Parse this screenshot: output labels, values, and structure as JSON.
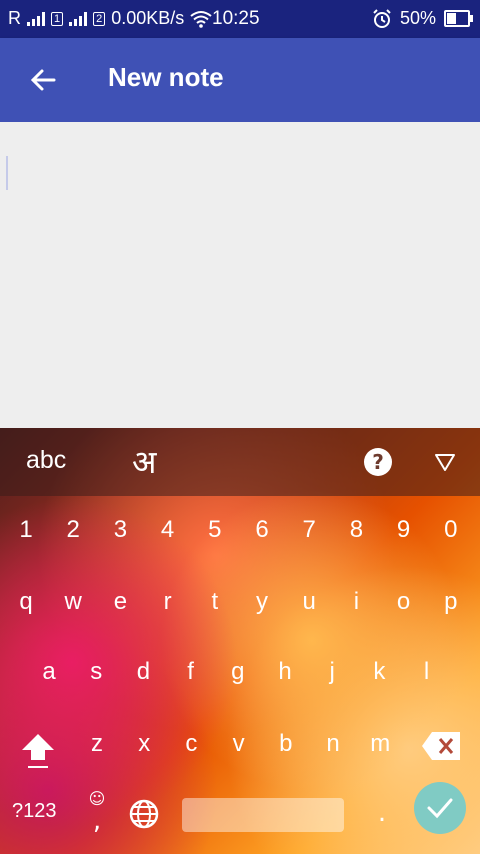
{
  "status_bar": {
    "sim1_label": "R",
    "sim1_slot": "1",
    "sim2_slot": "2",
    "speed": "0.00KB/s",
    "time": "10:25",
    "battery": "50%",
    "battery_level": 0.5
  },
  "app_bar": {
    "title": "New note",
    "back_icon": "arrow-left-icon"
  },
  "editor": {
    "placeholder": "",
    "value": ""
  },
  "keyboard": {
    "lang_latin": "abc",
    "lang_hindi": "अ",
    "help": "?",
    "numbers": [
      "1",
      "2",
      "3",
      "4",
      "5",
      "6",
      "7",
      "8",
      "9",
      "0"
    ],
    "row1": [
      "q",
      "w",
      "e",
      "r",
      "t",
      "y",
      "u",
      "i",
      "o",
      "p"
    ],
    "row2": [
      "a",
      "s",
      "d",
      "f",
      "g",
      "h",
      "j",
      "k",
      "l"
    ],
    "row3": [
      "z",
      "x",
      "c",
      "v",
      "b",
      "n",
      "m"
    ],
    "symbols_key": "?123",
    "emoji_top": "☺",
    "comma": ",",
    "period": ".",
    "colors": {
      "done_bg": "#80cbc4",
      "appbar": "#3f51b5",
      "statusbar": "#1a237e"
    }
  }
}
